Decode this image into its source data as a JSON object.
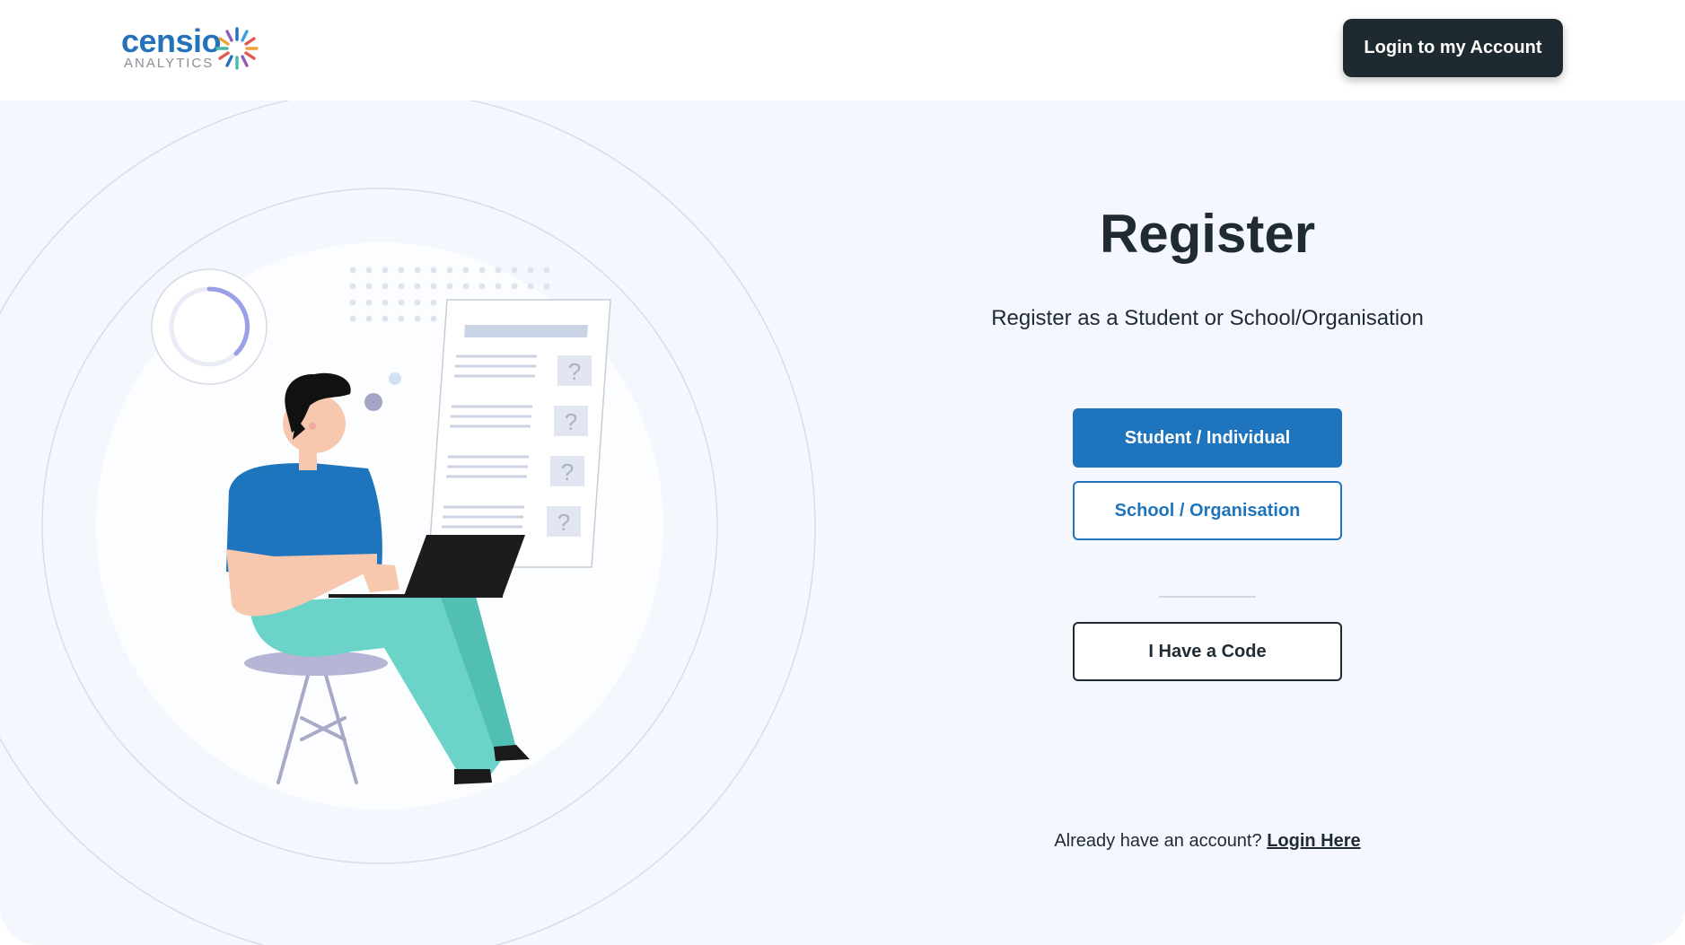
{
  "header": {
    "logo_word": "censio",
    "logo_sub": "ANALYTICS",
    "login_button": "Login to my Account"
  },
  "main": {
    "title": "Register",
    "subtitle": "Register as a Student or School/Organisation",
    "student_button": "Student / Individual",
    "school_button": "School / Organisation",
    "code_button": "I Have a Code",
    "already_text": "Already have an account?",
    "login_link": "Login Here"
  },
  "illustration": {
    "question_mark": "?"
  },
  "colors": {
    "primary_blue": "#1e74bd",
    "dark_button": "#1e2a30",
    "panel_background": "#f4f7fd",
    "logo_blue": "#2672b8"
  }
}
